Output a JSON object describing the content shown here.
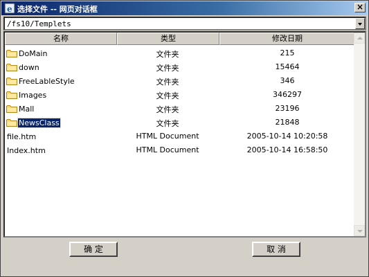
{
  "window": {
    "title": "选择文件 -- 网页对话框",
    "close_label": "×"
  },
  "path": {
    "value": "/fs10/Templets"
  },
  "columns": [
    "名称",
    "类型",
    "修改日期"
  ],
  "rows": [
    {
      "icon": "folder-icon",
      "name": "DoMain",
      "type": "文件夹",
      "date": "215"
    },
    {
      "icon": "folder-icon",
      "name": "down",
      "type": "文件夹",
      "date": "15464"
    },
    {
      "icon": "folder-icon",
      "name": "FreeLableStyle",
      "type": "文件夹",
      "date": "346"
    },
    {
      "icon": "folder-icon",
      "name": "Images",
      "type": "文件夹",
      "date": "346297"
    },
    {
      "icon": "folder-icon",
      "name": "Mall",
      "type": "文件夹",
      "date": "23196"
    },
    {
      "icon": "folder-icon",
      "name": "NewsClass",
      "type": "文件夹",
      "date": "21848",
      "selected": true
    },
    {
      "icon": null,
      "name": "file.htm",
      "type": "HTML Document",
      "date": "2005-10-14 10:20:58"
    },
    {
      "icon": null,
      "name": "Index.htm",
      "type": "HTML Document",
      "date": "2005-10-14 16:58:50"
    }
  ],
  "buttons": {
    "ok": "确 定",
    "cancel": "取 消"
  }
}
